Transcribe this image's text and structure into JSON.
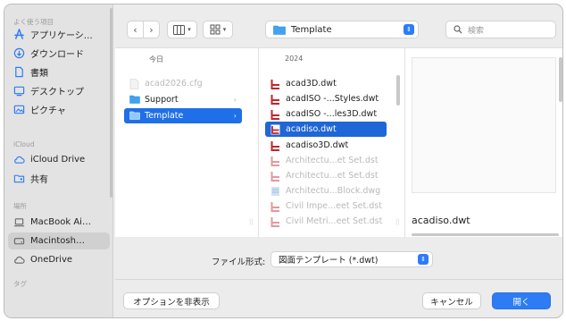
{
  "sidebar": {
    "sections": {
      "favorites": "よく使う項目",
      "icloud": "iCloud",
      "locations": "場所",
      "tags": "タグ"
    },
    "items": [
      {
        "label": "アプリケーシ…",
        "icon": "applications-icon"
      },
      {
        "label": "ダウンロード",
        "icon": "download-icon"
      },
      {
        "label": "書類",
        "icon": "document-icon"
      },
      {
        "label": "デスクトップ",
        "icon": "desktop-icon"
      },
      {
        "label": "ピクチャ",
        "icon": "pictures-icon"
      },
      {
        "label": "iCloud Drive",
        "icon": "cloud-icon"
      },
      {
        "label": "共有",
        "icon": "shared-folder-icon"
      },
      {
        "label": "MacBook Ai…",
        "icon": "laptop-icon"
      },
      {
        "label": "Macintosh…",
        "icon": "disk-icon"
      },
      {
        "label": "OneDrive",
        "icon": "cloud-icon"
      }
    ]
  },
  "toolbar": {
    "back": "‹",
    "forward": "›",
    "view_columns": "columns-view-icon",
    "view_grid": "grid-view-icon",
    "path": "Template",
    "search_placeholder": "検索"
  },
  "columns": [
    {
      "header": "今日",
      "rows": [
        {
          "name": "acad2026.cfg",
          "dim": true,
          "folder": false
        },
        {
          "name": "Support",
          "dim": false,
          "folder": true
        },
        {
          "name": "Template",
          "dim": false,
          "folder": true,
          "selected": true
        }
      ]
    },
    {
      "header": "2024",
      "rows": [
        {
          "name": "acad3D.dwt",
          "dim": false
        },
        {
          "name": "acadISO -...Styles.dwt",
          "dim": false
        },
        {
          "name": "acadISO -...les3D.dwt",
          "dim": false
        },
        {
          "name": "acadiso.dwt",
          "dim": false,
          "selected": true
        },
        {
          "name": "acadiso3D.dwt",
          "dim": false
        },
        {
          "name": "Architectu...et Set.dst",
          "dim": true
        },
        {
          "name": "Architectu...et Set.dst",
          "dim": true
        },
        {
          "name": "Architectu...Block.dwg",
          "dim": true
        },
        {
          "name": "Civil Impe...eet Set.dst",
          "dim": true
        },
        {
          "name": "Civil Metri...eet Set.dst",
          "dim": true
        }
      ]
    }
  ],
  "preview": {
    "filename": "acadiso.dwt"
  },
  "format": {
    "label": "ファイル形式:",
    "value": "図面テンプレート (*.dwt)"
  },
  "buttons": {
    "options": "オプションを非表示",
    "cancel": "キャンセル",
    "open": "開く"
  },
  "colors": {
    "accent": "#2d7cf6",
    "selection": "#1f6fe8",
    "dwg_red": "#c0262d"
  }
}
